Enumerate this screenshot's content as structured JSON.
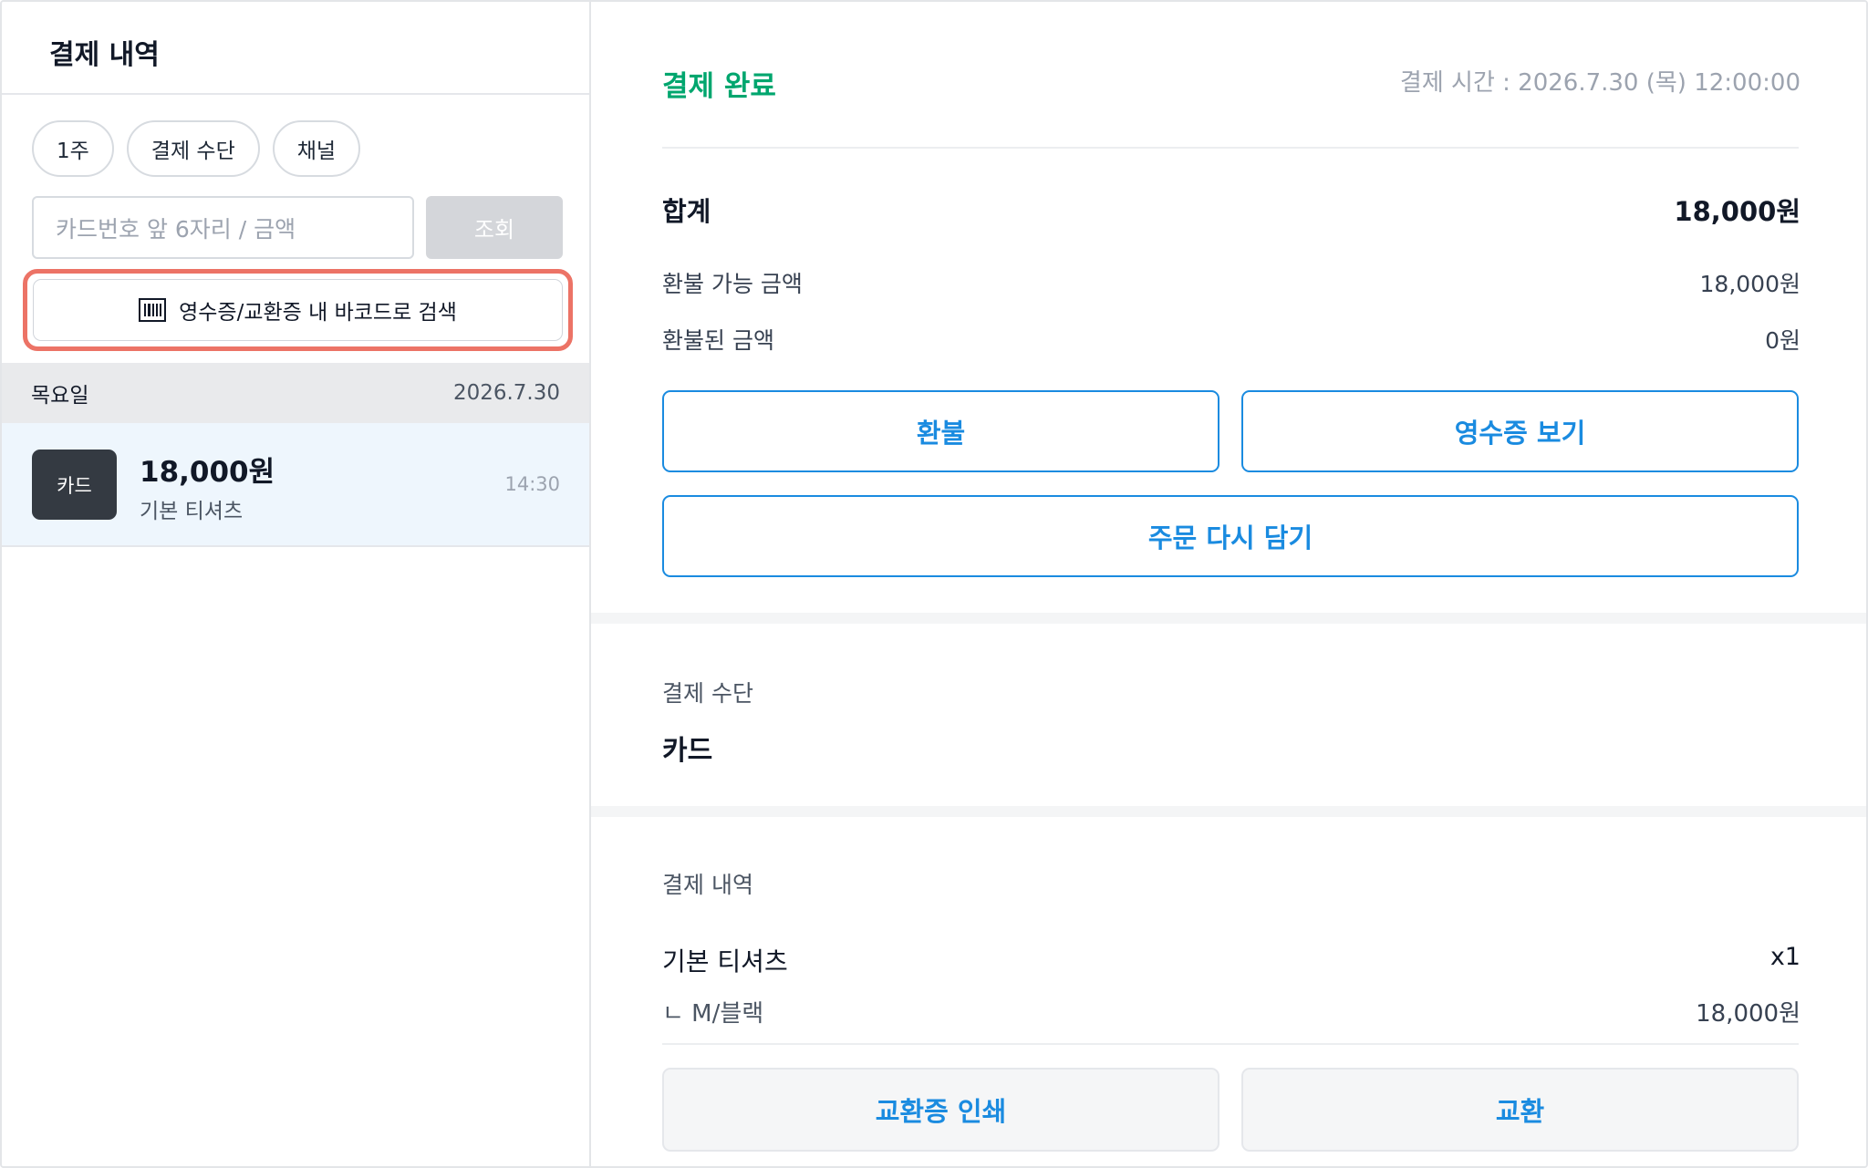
{
  "left": {
    "title": "결제 내역",
    "chips": [
      "1주",
      "결제 수단",
      "채널"
    ],
    "search": {
      "placeholder": "카드번호 앞 6자리 / 금액",
      "button": "조회"
    },
    "barcode_button": {
      "label": "영수증/교환증 내 바코드로 검색",
      "icon": "barcode-icon",
      "highlight_color": "#ec7366"
    },
    "day_group": {
      "day": "목요일",
      "date": "2026.7.30"
    },
    "transaction": {
      "badge": "카드",
      "amount": "18,000원",
      "description": "기본 티셔츠",
      "time": "14:30"
    }
  },
  "detail": {
    "status": "결제 완료",
    "pay_time": "결제 시간 : 2026.7.30 (목) 12:00:00",
    "total": {
      "label": "합계",
      "value": "18,000원"
    },
    "refundable": {
      "label": "환불 가능 금액",
      "value": "18,000원"
    },
    "refunded": {
      "label": "환불된 금액",
      "value": "0원"
    },
    "buttons": {
      "refund": "환불",
      "view_receipt": "영수증 보기",
      "reorder": "주문 다시 담기"
    },
    "payment_method": {
      "label": "결제 수단",
      "value": "카드"
    },
    "history": {
      "label": "결제 내역",
      "item_name": "기본 티셔츠",
      "quantity": "x1",
      "option": "ㄴ  M/블랙",
      "price": "18,000원"
    },
    "footer_buttons": {
      "print_exchange": "교환증 인쇄",
      "exchange": "교환"
    }
  },
  "colors": {
    "accent": "#1a8be0",
    "success": "#00a66e",
    "badge_bg": "#343a42"
  }
}
